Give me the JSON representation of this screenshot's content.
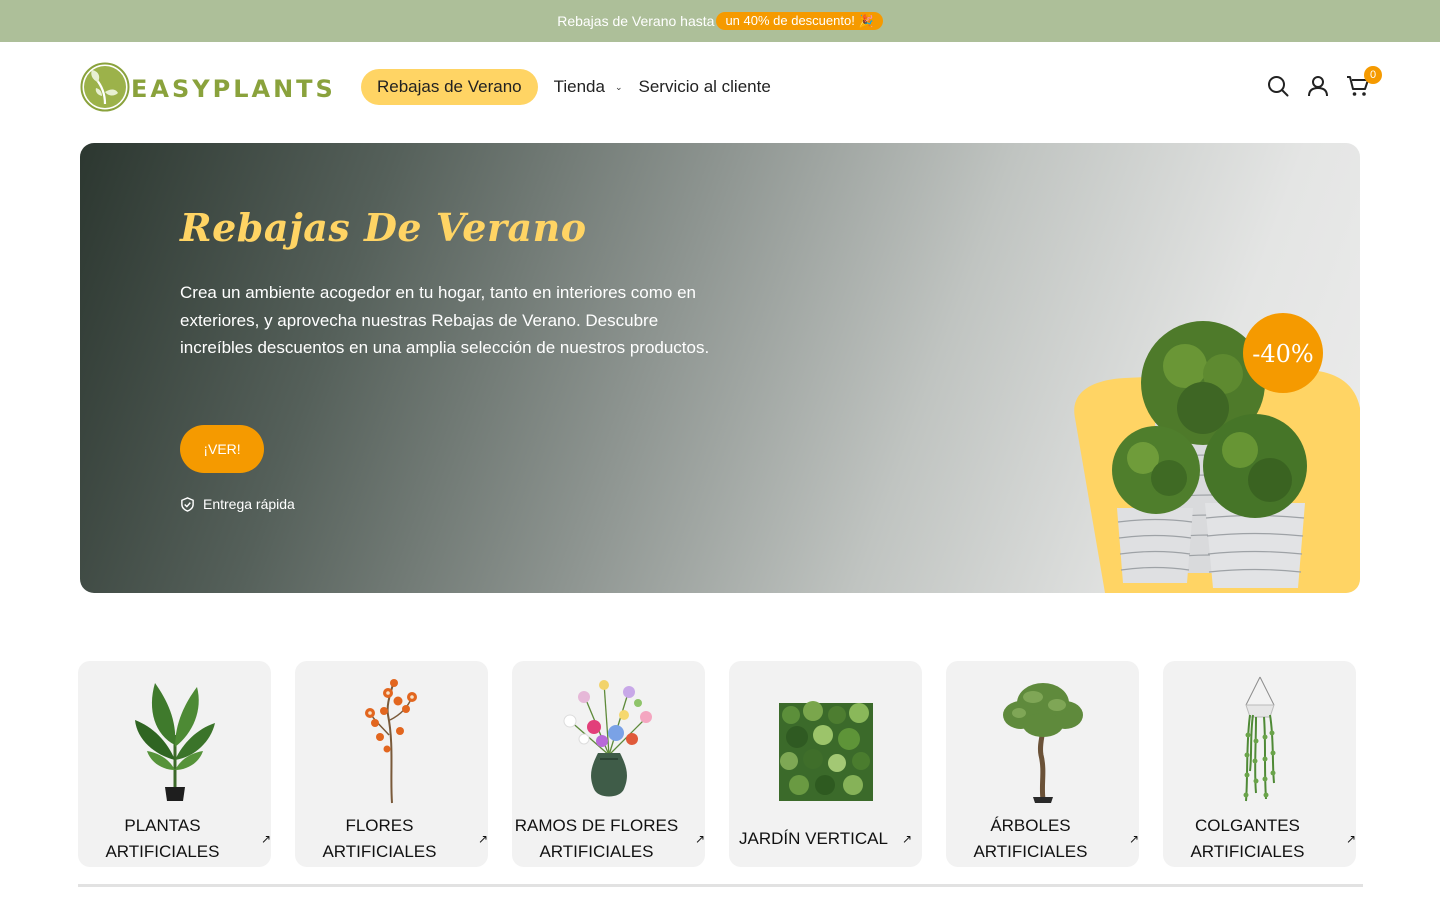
{
  "announcement": {
    "text": "Rebajas de Verano hasta",
    "highlight": "un 40% de descuento!",
    "highlight_color": "#f59a00",
    "bar_color": "#adbf99"
  },
  "header": {
    "logo_text": "EASYPLANTS",
    "nav": [
      {
        "label": "Rebajas de Verano",
        "highlighted": true
      },
      {
        "label": "Tienda",
        "dropdown": true
      },
      {
        "label": "Servicio al cliente"
      }
    ],
    "icons": [
      "search-icon",
      "account-icon",
      "cart-icon"
    ],
    "cart_count": "0"
  },
  "hero": {
    "title": "Rebajas De Verano",
    "description": "Crea un ambiente acogedor en tu hogar, tanto en interiores como en exteriores, y aprovecha nuestras Rebajas de Verano. Descubre increíbles descuentos en una amplia selección de nuestros productos.",
    "button_label": "¡VER!",
    "feature": "Entrega rápida",
    "discount_badge": "-40%",
    "accent_color": "#ffd464",
    "button_color": "#f59a00"
  },
  "categories": [
    {
      "label": "Plantas artificiales",
      "image": "banana-plant"
    },
    {
      "label": "Flores artificiales",
      "image": "orange-orchid-stem"
    },
    {
      "label": "Ramos de flores artificiales",
      "image": "bouquet-in-vase"
    },
    {
      "label": "Jardín vertical",
      "image": "green-wall-panel"
    },
    {
      "label": "Árboles artificiales",
      "image": "olive-tree"
    },
    {
      "label": "Colgantes artificiales",
      "image": "hanging-plant"
    }
  ]
}
